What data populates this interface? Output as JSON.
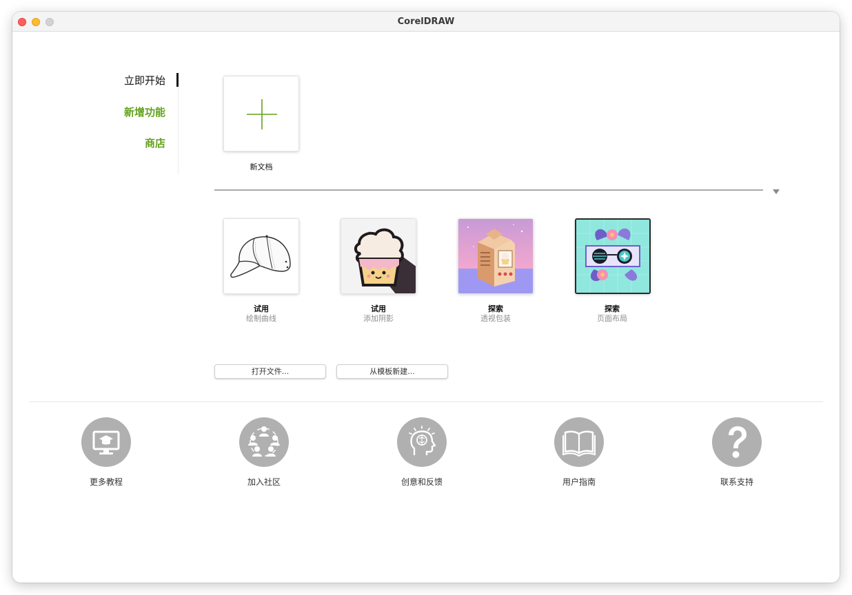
{
  "window": {
    "title": "CorelDRAW"
  },
  "sidebar": {
    "items": [
      {
        "label": "立即开始"
      },
      {
        "label": "新增功能"
      },
      {
        "label": "商店"
      }
    ]
  },
  "new_document": {
    "label": "新文档"
  },
  "tutorials": [
    {
      "title": "试用",
      "subtitle": "绘制曲线",
      "icon": "baseball-cap-icon"
    },
    {
      "title": "试用",
      "subtitle": "添加阴影",
      "icon": "cupcake-icon"
    },
    {
      "title": "探索",
      "subtitle": "透视包装",
      "icon": "milk-carton-icon"
    },
    {
      "title": "探索",
      "subtitle": "页面布局",
      "icon": "sunglasses-icon"
    }
  ],
  "buttons": {
    "open_file": "打开文件...",
    "new_from_template": "从模板新建..."
  },
  "bottom_links": [
    {
      "label": "更多教程",
      "icon": "monitor-graduation-icon"
    },
    {
      "label": "加入社区",
      "icon": "community-people-icon"
    },
    {
      "label": "创意和反馈",
      "icon": "brain-head-icon"
    },
    {
      "label": "用户指南",
      "icon": "open-book-icon"
    },
    {
      "label": "联系支持",
      "icon": "question-mark-icon"
    }
  ],
  "colors": {
    "accent_green": "#63a21d",
    "icon_gray": "#b0b0b0"
  }
}
